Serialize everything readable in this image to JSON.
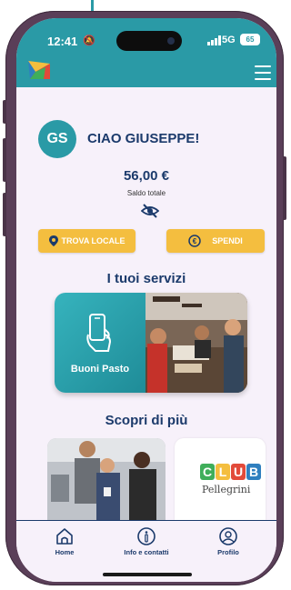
{
  "status_bar": {
    "time": "12:41",
    "network": "5G",
    "battery": "65"
  },
  "header": {
    "logo": "app-logo",
    "menu": "hamburger-menu-icon"
  },
  "user": {
    "initials": "GS",
    "greeting": "CIAO GIUSEPPE!"
  },
  "wallet": {
    "amount": "56,00 €",
    "label": "Saldo totale",
    "visibility_icon": "eye-slash-icon"
  },
  "actions": {
    "find_label": "TROVA LOCALE",
    "spend_label": "SPENDI"
  },
  "services": {
    "title": "I tuoi servizi",
    "card_label": "Buoni Pasto"
  },
  "discover": {
    "title": "Scopri di più",
    "club_letters": [
      "C",
      "L",
      "U",
      "B"
    ],
    "club_subtitle": "Pellegrini"
  },
  "tabbar": {
    "home": "Home",
    "info": "Info e contatti",
    "profile": "Profilo"
  },
  "colors": {
    "primary": "#2a9aa6",
    "accent": "#f4be3f",
    "navy": "#1b3a6b",
    "background": "#f7f1fa"
  }
}
